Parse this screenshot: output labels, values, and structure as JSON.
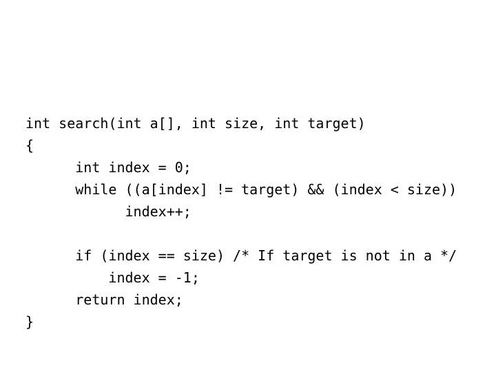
{
  "page": {
    "background_color": "#ffffff",
    "text_color": "#000000",
    "kind": "code-listing",
    "language": "C"
  },
  "code": {
    "function_name": "search",
    "lines": [
      {
        "indent": 0,
        "text": "int search(int a[], int size, int target)"
      },
      {
        "indent": 0,
        "text": "{"
      },
      {
        "indent": 6,
        "text": "int index = 0;"
      },
      {
        "indent": 6,
        "text": "while ((a[index] != target) && (index < size))"
      },
      {
        "indent": 12,
        "text": "index++;"
      },
      {
        "indent": 0,
        "text": ""
      },
      {
        "indent": 6,
        "text": "if (index == size) /* If target is not in a */"
      },
      {
        "indent": 10,
        "text": "index = -1;"
      },
      {
        "indent": 6,
        "text": "return index;"
      },
      {
        "indent": 0,
        "text": "}"
      }
    ],
    "full_text": "int search(int a[], int size, int target)\n{\n      int index = 0;\n      while ((a[index] != target) && (index < size))\n            index++;\n\n      if (index == size) /* If target is not in a */\n          index = -1;\n      return index;\n}"
  }
}
